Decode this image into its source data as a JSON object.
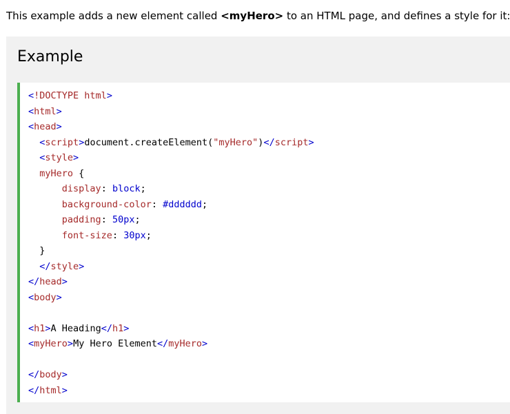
{
  "intro": {
    "prefix": "This example adds a new element called ",
    "element": "<myHero>",
    "suffix": " to an HTML page, and defines a style for it:"
  },
  "example": {
    "title": "Example",
    "code_lines": [
      [
        {
          "t": "brk",
          "v": "<"
        },
        {
          "t": "tag",
          "v": "!DOCTYPE html"
        },
        {
          "t": "brk",
          "v": ">"
        }
      ],
      [
        {
          "t": "brk",
          "v": "<"
        },
        {
          "t": "tag",
          "v": "html"
        },
        {
          "t": "brk",
          "v": ">"
        }
      ],
      [
        {
          "t": "brk",
          "v": "<"
        },
        {
          "t": "tag",
          "v": "head"
        },
        {
          "t": "brk",
          "v": ">"
        }
      ],
      [
        {
          "t": "txt",
          "v": "  "
        },
        {
          "t": "brk",
          "v": "<"
        },
        {
          "t": "tag",
          "v": "script"
        },
        {
          "t": "brk",
          "v": ">"
        },
        {
          "t": "txt",
          "v": "document.createElement("
        },
        {
          "t": "str",
          "v": "\"myHero\""
        },
        {
          "t": "txt",
          "v": ")"
        },
        {
          "t": "brk",
          "v": "</"
        },
        {
          "t": "tag",
          "v": "script"
        },
        {
          "t": "brk",
          "v": ">"
        }
      ],
      [
        {
          "t": "txt",
          "v": "  "
        },
        {
          "t": "brk",
          "v": "<"
        },
        {
          "t": "tag",
          "v": "style"
        },
        {
          "t": "brk",
          "v": ">"
        }
      ],
      [
        {
          "t": "txt",
          "v": "  "
        },
        {
          "t": "sel",
          "v": "myHero"
        },
        {
          "t": "txt",
          "v": " {"
        }
      ],
      [
        {
          "t": "txt",
          "v": "      "
        },
        {
          "t": "prop",
          "v": "display"
        },
        {
          "t": "txt",
          "v": ": "
        },
        {
          "t": "val",
          "v": "block"
        },
        {
          "t": "txt",
          "v": ";"
        }
      ],
      [
        {
          "t": "txt",
          "v": "      "
        },
        {
          "t": "prop",
          "v": "background-color"
        },
        {
          "t": "txt",
          "v": ": "
        },
        {
          "t": "val",
          "v": "#dddddd"
        },
        {
          "t": "txt",
          "v": ";"
        }
      ],
      [
        {
          "t": "txt",
          "v": "      "
        },
        {
          "t": "prop",
          "v": "padding"
        },
        {
          "t": "txt",
          "v": ": "
        },
        {
          "t": "val",
          "v": "50px"
        },
        {
          "t": "txt",
          "v": ";"
        }
      ],
      [
        {
          "t": "txt",
          "v": "      "
        },
        {
          "t": "prop",
          "v": "font-size"
        },
        {
          "t": "txt",
          "v": ": "
        },
        {
          "t": "val",
          "v": "30px"
        },
        {
          "t": "txt",
          "v": ";"
        }
      ],
      [
        {
          "t": "txt",
          "v": "  }"
        }
      ],
      [
        {
          "t": "txt",
          "v": "  "
        },
        {
          "t": "brk",
          "v": "</"
        },
        {
          "t": "tag",
          "v": "style"
        },
        {
          "t": "brk",
          "v": ">"
        }
      ],
      [
        {
          "t": "brk",
          "v": "</"
        },
        {
          "t": "tag",
          "v": "head"
        },
        {
          "t": "brk",
          "v": ">"
        }
      ],
      [
        {
          "t": "brk",
          "v": "<"
        },
        {
          "t": "tag",
          "v": "body"
        },
        {
          "t": "brk",
          "v": ">"
        }
      ],
      [],
      [
        {
          "t": "brk",
          "v": "<"
        },
        {
          "t": "tag",
          "v": "h1"
        },
        {
          "t": "brk",
          "v": ">"
        },
        {
          "t": "txt",
          "v": "A Heading"
        },
        {
          "t": "brk",
          "v": "</"
        },
        {
          "t": "tag",
          "v": "h1"
        },
        {
          "t": "brk",
          "v": ">"
        }
      ],
      [
        {
          "t": "brk",
          "v": "<"
        },
        {
          "t": "tag",
          "v": "myHero"
        },
        {
          "t": "brk",
          "v": ">"
        },
        {
          "t": "txt",
          "v": "My Hero Element"
        },
        {
          "t": "brk",
          "v": "</"
        },
        {
          "t": "tag",
          "v": "myHero"
        },
        {
          "t": "brk",
          "v": ">"
        }
      ],
      [],
      [
        {
          "t": "brk",
          "v": "</"
        },
        {
          "t": "tag",
          "v": "body"
        },
        {
          "t": "brk",
          "v": ">"
        }
      ],
      [
        {
          "t": "brk",
          "v": "</"
        },
        {
          "t": "tag",
          "v": "html"
        },
        {
          "t": "brk",
          "v": ">"
        }
      ]
    ]
  },
  "colors": {
    "accent_border": "#4caf50",
    "box_background": "#f1f1f1",
    "code_background": "#ffffff",
    "tag": "#a52a2a",
    "bracket": "#0000cd"
  }
}
